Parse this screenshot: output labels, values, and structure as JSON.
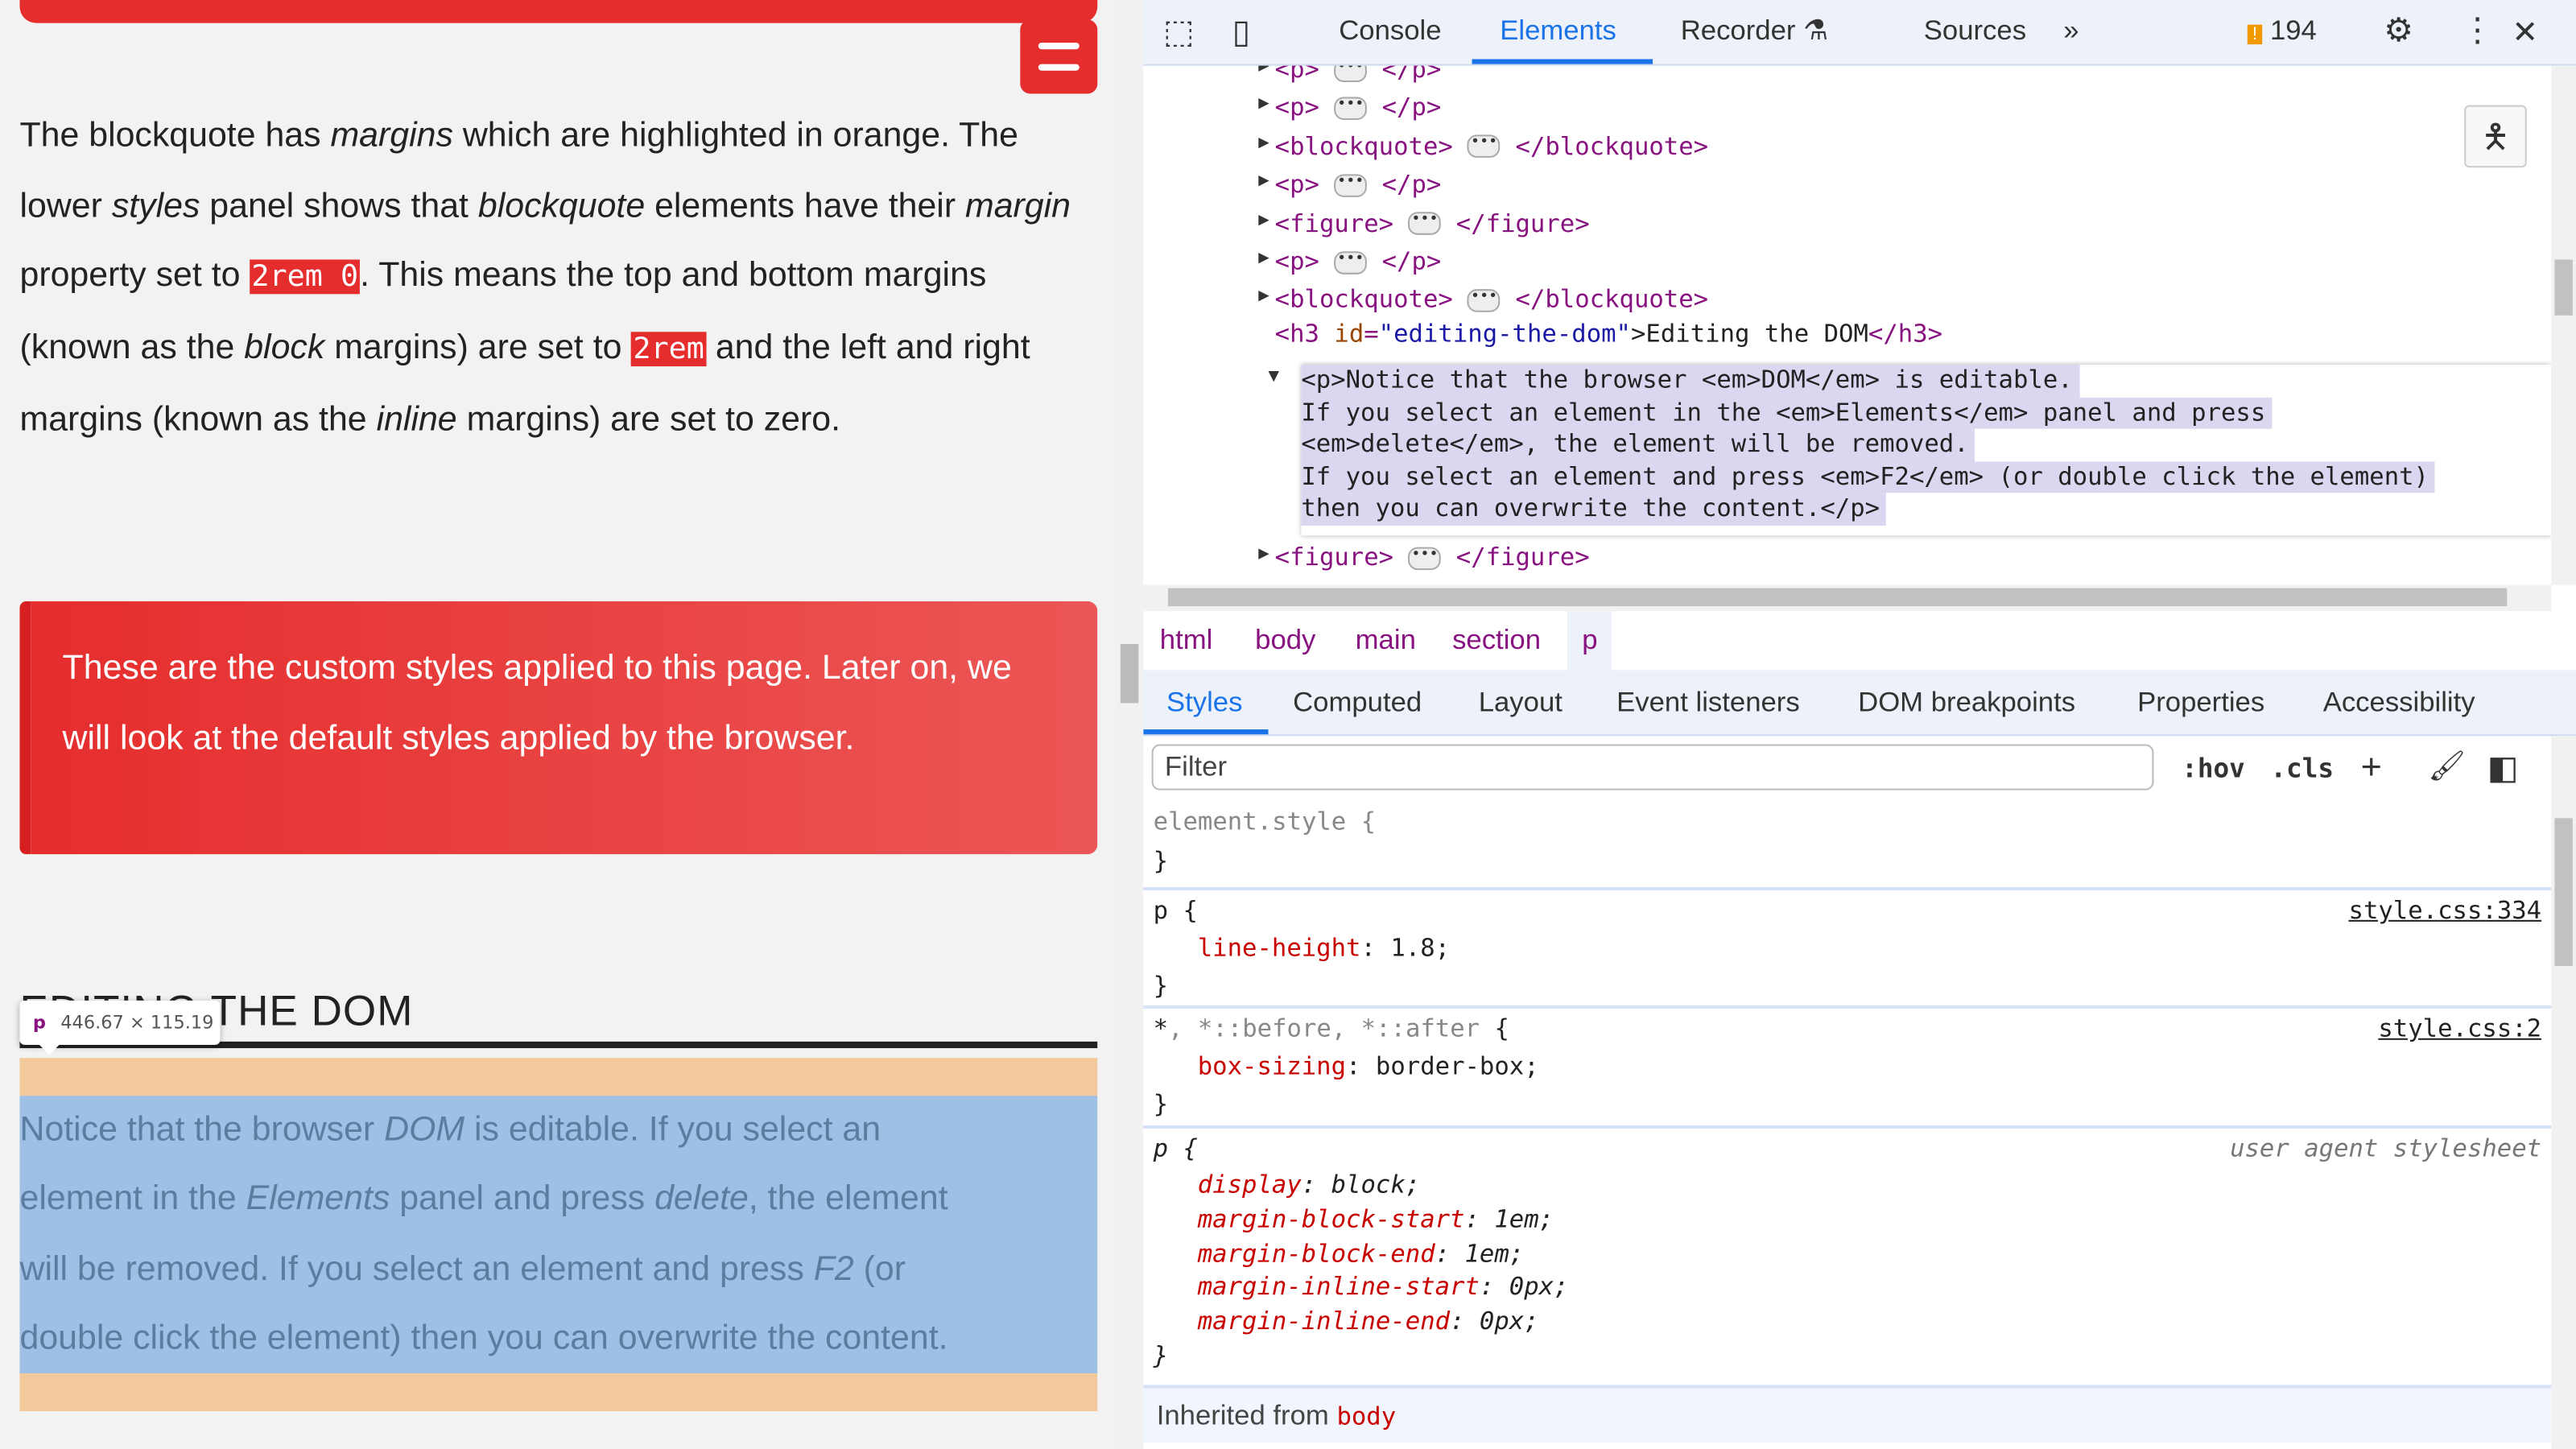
{
  "page": {
    "paragraph1": [
      {
        "t": "The blockquote has "
      },
      {
        "em": "margins"
      },
      {
        "t": " which are highlighted in orange. The lower "
      },
      {
        "em": "styles"
      },
      {
        "t": " panel shows that "
      },
      {
        "em": "blockquote"
      },
      {
        "t": " elements have their "
      },
      {
        "em": "margin"
      },
      {
        "t": " property set to "
      },
      {
        "code": "2rem 0"
      },
      {
        "t": ". This means the top and bottom margins (known as the "
      },
      {
        "em": "block"
      },
      {
        "t": " margins) are set to "
      },
      {
        "code": "2rem"
      },
      {
        "t": " and the left and right margins (known as the "
      },
      {
        "em": "inline"
      },
      {
        "t": " margins) are set to zero."
      }
    ],
    "callout": "These are the custom styles applied to this page. Later on, we will look at the default styles applied by the browser.",
    "heading": "EDITING THE DOM",
    "tooltip": {
      "tag": "p",
      "size": "446.67 × 115.19"
    },
    "highlighted_lines": [
      [
        {
          "t": "Notice that the browser "
        },
        {
          "em": "DOM"
        },
        {
          "t": " is editable. If you select an"
        }
      ],
      [
        {
          "t": "element in the "
        },
        {
          "em": "Elements"
        },
        {
          "t": " panel and press "
        },
        {
          "em": "delete"
        },
        {
          "t": ", the element"
        }
      ],
      [
        {
          "t": "will be removed. If you select an element and press "
        },
        {
          "em": "F2"
        },
        {
          "t": " (or"
        }
      ],
      [
        {
          "t": "double click the element) then you can overwrite the content."
        }
      ]
    ],
    "colors": {
      "accent": "#e62d2d",
      "margin": "#f3c89a",
      "content": "#9dc0e4"
    }
  },
  "devtools": {
    "tabs": {
      "console": "Console",
      "elements": "Elements",
      "recorder": "Recorder",
      "sources": "Sources"
    },
    "issues_count": "194",
    "dom_rows": [
      {
        "open": "<p>",
        "close": "</p>"
      },
      {
        "open": "<p>",
        "close": "</p>"
      },
      {
        "open": "<blockquote>",
        "close": "</blockquote>"
      },
      {
        "open": "<p>",
        "close": "</p>"
      },
      {
        "open": "<figure>",
        "close": "</figure>"
      },
      {
        "open": "<p>",
        "close": "</p>"
      },
      {
        "open": "<blockquote>",
        "close": "</blockquote>"
      }
    ],
    "h3": {
      "tag_open": "<h3 ",
      "attr": "id",
      "value": "\"editing-the-dom\"",
      "text": ">Editing the DOM",
      "tag_close": "</h3>"
    },
    "selected_lines": [
      "<p>Notice that the browser <em>DOM</em> is editable.",
      "If you select an element in the <em>Elements</em> panel and press",
      "<em>delete</em>, the element will be removed.",
      "If you select an element and press <em>F2</em> (or double click the element)",
      "then you can overwrite the content.</p>"
    ],
    "after_row": {
      "open": "<figure>",
      "close": "</figure>"
    },
    "breadcrumbs": [
      "html",
      "body",
      "main",
      "section",
      "p"
    ],
    "panel_tabs": [
      "Styles",
      "Computed",
      "Layout",
      "Event listeners",
      "DOM breakpoints",
      "Properties",
      "Accessibility"
    ],
    "filter_placeholder": "Filter",
    "hov": ":hov",
    "cls": ".cls",
    "rules": {
      "element_style": "element.style {",
      "r1": {
        "selector": "p {",
        "source": "style.css:334",
        "prop": "line-height",
        "value": " 1.8;"
      },
      "r2": {
        "selector_a": "*",
        "selector_b": ", *::before, *::after",
        "brace": " {",
        "source": "style.css:2",
        "prop": "box-sizing",
        "value": " border-box;"
      },
      "r3": {
        "selector": "p {",
        "source": "user agent stylesheet",
        "props": [
          [
            "display",
            " block;"
          ],
          [
            "margin-block-start",
            " 1em;"
          ],
          [
            "margin-block-end",
            " 1em;"
          ],
          [
            "margin-inline-start",
            " 0px;"
          ],
          [
            "margin-inline-end",
            " 0px;"
          ]
        ]
      },
      "close": "}"
    },
    "inherited_label": "Inherited from",
    "inherited_tag": "body"
  }
}
